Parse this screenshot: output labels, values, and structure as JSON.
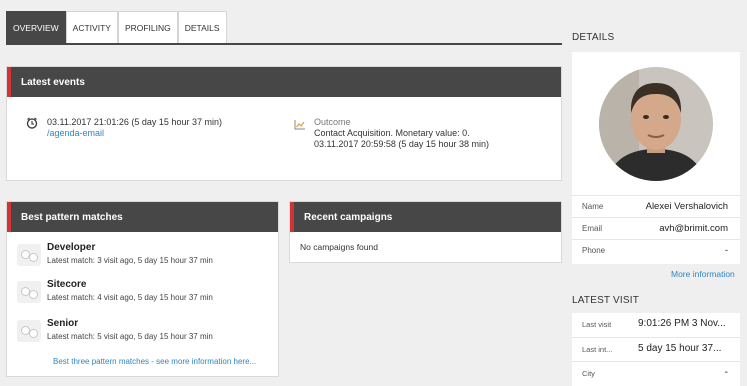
{
  "tabs": [
    "OVERVIEW",
    "ACTIVITY",
    "PROFILING",
    "DETAILS"
  ],
  "latest_events": {
    "title": "Latest events",
    "event1": {
      "time": "03.11.2017 21:01:26 (5 day 15 hour 37 min)",
      "page": "/agenda-email",
      "icon": "clock-icon"
    },
    "event2": {
      "label": "Outcome",
      "line1": "Contact Acquisition. Monetary value: 0.",
      "line2": "03.11.2017 20:59:58 (5 day 15 hour 38 min)",
      "icon": "chart-icon"
    }
  },
  "patterns": {
    "title": "Best pattern matches",
    "items": [
      {
        "name": "Developer",
        "desc": "Latest match: 3 visit ago, 5 day 15 hour 37 min"
      },
      {
        "name": "Sitecore",
        "desc": "Latest match: 4 visit ago, 5 day 15 hour 37 min"
      },
      {
        "name": "Senior",
        "desc": "Latest match: 5 visit ago, 5 day 15 hour 37 min"
      }
    ],
    "more_link": "Best three pattern matches - see more information here..."
  },
  "campaigns": {
    "title": "Recent campaigns",
    "empty": "No campaigns found"
  },
  "details": {
    "title": "DETAILS",
    "name_label": "Name",
    "name": "Alexei Vershalovich",
    "email_label": "Email",
    "email": "avh@brimit.com",
    "phone_label": "Phone",
    "phone": "-",
    "more": "More information"
  },
  "latest_visit": {
    "title": "LATEST VISIT",
    "rows": [
      {
        "label": "Last visit",
        "value": "9:01:26 PM 3 Nov..."
      },
      {
        "label": "Last int...",
        "value": "5 day 15 hour 37..."
      },
      {
        "label": "City",
        "value": "-"
      }
    ]
  },
  "colors": {
    "accent": "#d13434",
    "header": "#474747",
    "link": "#2f86c5"
  }
}
